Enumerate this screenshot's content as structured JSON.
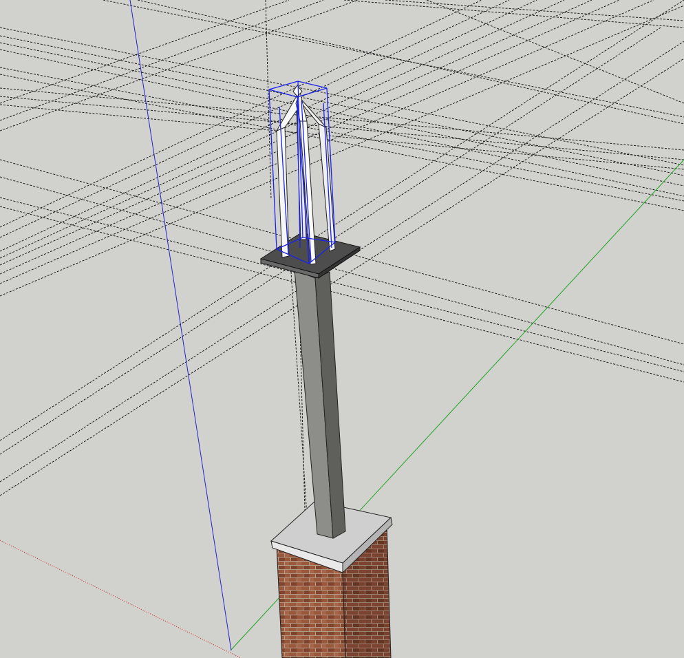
{
  "app": {
    "type": "3d-modeling-viewport",
    "canvas_color": "#d1d1ce"
  },
  "axes": {
    "red": {
      "color": "#cc2222",
      "style": "dotted"
    },
    "green": {
      "color": "#1fa31f",
      "style": "solid"
    },
    "blue": {
      "color": "#2222cc",
      "style": "solid"
    }
  },
  "guides": {
    "color": "#1a1a1a",
    "style": "dashed",
    "count": 36
  },
  "model": {
    "components": [
      {
        "name": "brick-pier",
        "material": "brick",
        "color": "#8a4a33"
      },
      {
        "name": "pier-cap",
        "material": "concrete",
        "color": "#c8c8c8"
      },
      {
        "name": "steel-post",
        "material": "steel",
        "color": "#8d8d8a"
      },
      {
        "name": "base-plate",
        "material": "steel-plate",
        "color": "#4f4f4f"
      },
      {
        "name": "finial-frame",
        "material": "white-paint",
        "color": "#f4f4f4",
        "selected": true,
        "selection_color": "#1a22ee"
      }
    ]
  }
}
